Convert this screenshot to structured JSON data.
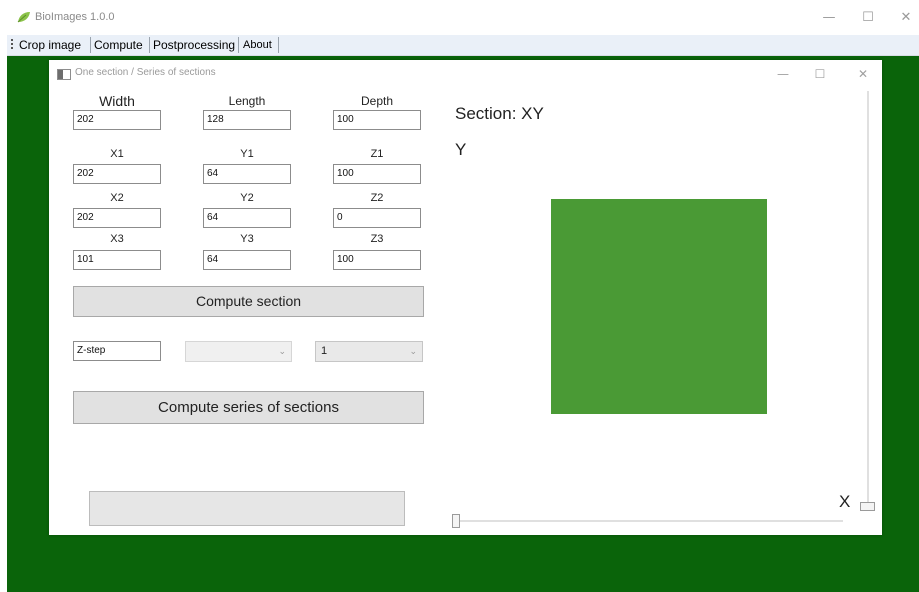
{
  "app": {
    "title": "BioImages 1.0.0",
    "icon": "leaf-icon",
    "controls": {
      "minimize": "—",
      "maximize": "☐",
      "close": "✕"
    }
  },
  "menu": {
    "items": [
      "Crop image",
      "Compute",
      "Postprocessing",
      "About"
    ]
  },
  "window": {
    "title": "One section / Series of sections",
    "controls": {
      "minimize": "—",
      "maximize": "☐",
      "close": "✕"
    }
  },
  "dimensions": {
    "width_label": "Width",
    "width_value": "202",
    "length_label": "Length",
    "length_value": "128",
    "depth_label": "Depth",
    "depth_value": "100"
  },
  "points": [
    {
      "x_label": "X1",
      "x": "202",
      "y_label": "Y1",
      "y": "64",
      "z_label": "Z1",
      "z": "100"
    },
    {
      "x_label": "X2",
      "x": "202",
      "y_label": "Y2",
      "y": "64",
      "z_label": "Z2",
      "z": "0"
    },
    {
      "x_label": "X3",
      "x": "101",
      "y_label": "Y3",
      "y": "64",
      "z_label": "Z3",
      "z": "100"
    }
  ],
  "buttons": {
    "compute_section": "Compute section",
    "compute_series": "Compute series of sections"
  },
  "series": {
    "step_value": "Z-step",
    "count_dropdown": "",
    "step_dropdown": "1"
  },
  "view": {
    "section_label": "Section: XY",
    "y_axis": "Y",
    "x_axis": "X",
    "section_color": "#4a9a35"
  },
  "colors": {
    "desktop": "#0a640a",
    "menubar": "#eaf0f8"
  }
}
